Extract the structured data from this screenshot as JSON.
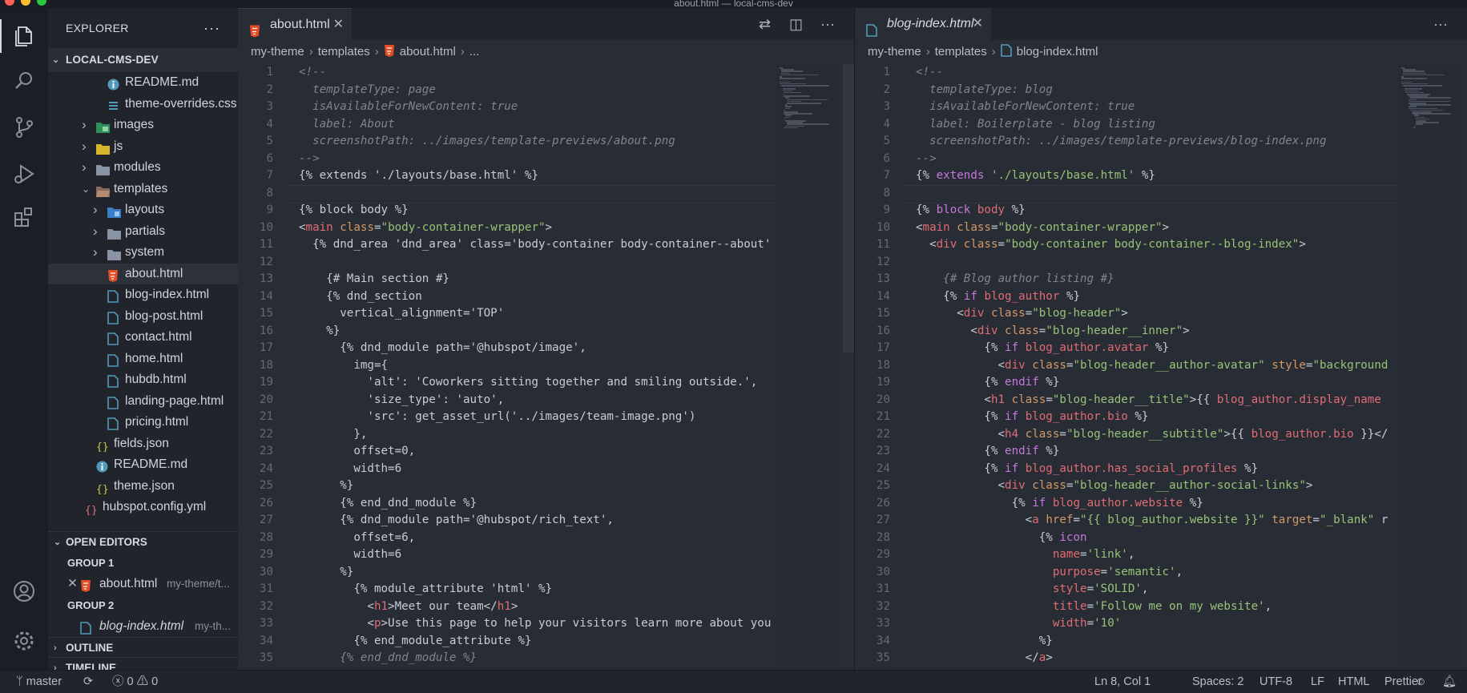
{
  "window": {
    "title": "about.html — local-cms-dev"
  },
  "explorer": {
    "title": "EXPLORER",
    "more": "···",
    "project": "LOCAL-CMS-DEV",
    "tree": [
      {
        "label": "README.md",
        "icon": "info-icon",
        "indent": 3,
        "chevron": ""
      },
      {
        "label": "theme-overrides.css",
        "icon": "css-icon",
        "indent": 3,
        "chevron": ""
      },
      {
        "label": "images",
        "icon": "image-folder-icon",
        "indent": 2,
        "chevron": "›"
      },
      {
        "label": "js",
        "icon": "js-folder-icon",
        "indent": 2,
        "chevron": "›"
      },
      {
        "label": "modules",
        "icon": "folder-icon",
        "indent": 2,
        "chevron": "›"
      },
      {
        "label": "templates",
        "icon": "open-folder-icon",
        "indent": 2,
        "chevron": "⌄"
      },
      {
        "label": "layouts",
        "icon": "layout-folder-icon",
        "indent": 3,
        "chevron": "›"
      },
      {
        "label": "partials",
        "icon": "folder-icon",
        "indent": 3,
        "chevron": "›"
      },
      {
        "label": "system",
        "icon": "folder-icon",
        "indent": 3,
        "chevron": "›"
      },
      {
        "label": "about.html",
        "icon": "html-icon",
        "indent": 3,
        "chevron": "",
        "selected": true
      },
      {
        "label": "blog-index.html",
        "icon": "file-icon",
        "indent": 3,
        "chevron": ""
      },
      {
        "label": "blog-post.html",
        "icon": "file-icon",
        "indent": 3,
        "chevron": ""
      },
      {
        "label": "contact.html",
        "icon": "file-icon",
        "indent": 3,
        "chevron": ""
      },
      {
        "label": "home.html",
        "icon": "file-icon",
        "indent": 3,
        "chevron": ""
      },
      {
        "label": "hubdb.html",
        "icon": "file-icon",
        "indent": 3,
        "chevron": ""
      },
      {
        "label": "landing-page.html",
        "icon": "file-icon",
        "indent": 3,
        "chevron": ""
      },
      {
        "label": "pricing.html",
        "icon": "file-icon",
        "indent": 3,
        "chevron": ""
      },
      {
        "label": "fields.json",
        "icon": "json-icon",
        "indent": 2,
        "chevron": ""
      },
      {
        "label": "README.md",
        "icon": "info-icon",
        "indent": 2,
        "chevron": ""
      },
      {
        "label": "theme.json",
        "icon": "json-icon",
        "indent": 2,
        "chevron": ""
      },
      {
        "label": "hubspot.config.yml",
        "icon": "yml-icon",
        "indent": 1,
        "chevron": ""
      }
    ],
    "open_editors": {
      "title": "OPEN EDITORS",
      "group1": "GROUP 1",
      "group1_file": "about.html",
      "group1_path": "my-theme/t...",
      "group2": "GROUP 2",
      "group2_file": "blog-index.html",
      "group2_path": "my-th..."
    },
    "outline": "OUTLINE",
    "timeline": "TIMELINE"
  },
  "editor_left": {
    "tab": "about.html",
    "breadcrumb": [
      "my-theme",
      "templates",
      "about.html",
      "..."
    ],
    "lines": [
      [
        [
          "c-cm",
          "<!--"
        ]
      ],
      [
        [
          "c-cm",
          "  templateType: page"
        ]
      ],
      [
        [
          "c-cm",
          "  isAvailableForNewContent: true"
        ]
      ],
      [
        [
          "c-cm",
          "  label: About"
        ]
      ],
      [
        [
          "c-cm",
          "  screenshotPath: ../images/template-previews/about.png"
        ]
      ],
      [
        [
          "c-cm",
          "-->"
        ]
      ],
      [
        [
          "c-tpl",
          "{% extends './layouts/base.html' %}"
        ]
      ],
      [
        [
          "c-tpl",
          ""
        ]
      ],
      [
        [
          "c-tpl",
          "{% block body %}"
        ]
      ],
      [
        [
          "c-tpl",
          "<"
        ],
        [
          "c-tag",
          "main"
        ],
        [
          "c-tpl",
          " "
        ],
        [
          "c-attr",
          "class"
        ],
        [
          "c-tpl",
          "="
        ],
        [
          "c-str",
          "\"body-container-wrapper\""
        ],
        [
          "c-tpl",
          ">"
        ]
      ],
      [
        [
          "c-tpl",
          "  {% dnd_area 'dnd_area' class='body-container body-container--about'"
        ]
      ],
      [
        [
          "c-tpl",
          ""
        ]
      ],
      [
        [
          "c-tpl",
          "    {# Main section #}"
        ]
      ],
      [
        [
          "c-tpl",
          "    {% dnd_section"
        ]
      ],
      [
        [
          "c-tpl",
          "      vertical_alignment='TOP'"
        ]
      ],
      [
        [
          "c-tpl",
          "    %}"
        ]
      ],
      [
        [
          "c-tpl",
          "      {% dnd_module path='@hubspot/image',"
        ]
      ],
      [
        [
          "c-tpl",
          "        img={"
        ]
      ],
      [
        [
          "c-tpl",
          "          'alt': 'Coworkers sitting together and smiling outside.',"
        ]
      ],
      [
        [
          "c-tpl",
          "          'size_type': 'auto',"
        ]
      ],
      [
        [
          "c-tpl",
          "          'src': get_asset_url('../images/team-image.png')"
        ]
      ],
      [
        [
          "c-tpl",
          "        },"
        ]
      ],
      [
        [
          "c-tpl",
          "        offset=0,"
        ]
      ],
      [
        [
          "c-tpl",
          "        width=6"
        ]
      ],
      [
        [
          "c-tpl",
          "      %}"
        ]
      ],
      [
        [
          "c-tpl",
          "      {% end_dnd_module %}"
        ]
      ],
      [
        [
          "c-tpl",
          "      {% dnd_module path='@hubspot/rich_text',"
        ]
      ],
      [
        [
          "c-tpl",
          "        offset=6,"
        ]
      ],
      [
        [
          "c-tpl",
          "        width=6"
        ]
      ],
      [
        [
          "c-tpl",
          "      %}"
        ]
      ],
      [
        [
          "c-tpl",
          "        {% module_attribute 'html' %}"
        ]
      ],
      [
        [
          "c-tpl",
          "          <"
        ],
        [
          "c-tag",
          "h1"
        ],
        [
          "c-tpl",
          ">Meet our team</"
        ],
        [
          "c-tag",
          "h1"
        ],
        [
          "c-tpl",
          ">"
        ]
      ],
      [
        [
          "c-tpl",
          "          <"
        ],
        [
          "c-tag",
          "p"
        ],
        [
          "c-tpl",
          ">Use this page to help your visitors learn more about you"
        ]
      ],
      [
        [
          "c-tpl",
          "        {% end_module_attribute %}"
        ]
      ],
      [
        [
          "c-cm",
          "      {% end_dnd_module %}"
        ]
      ]
    ]
  },
  "editor_right": {
    "tab": "blog-index.html",
    "breadcrumb": [
      "my-theme",
      "templates",
      "blog-index.html"
    ],
    "lines": [
      [
        [
          "c-cm",
          "<!--"
        ]
      ],
      [
        [
          "c-cm",
          "  templateType: blog"
        ]
      ],
      [
        [
          "c-cm",
          "  isAvailableForNewContent: true"
        ]
      ],
      [
        [
          "c-cm",
          "  label: Boilerplate - blog listing"
        ]
      ],
      [
        [
          "c-cm",
          "  screenshotPath: ../images/template-previews/blog-index.png"
        ]
      ],
      [
        [
          "c-cm",
          "-->"
        ]
      ],
      [
        [
          "c-tpl",
          "{% "
        ],
        [
          "c-kw",
          "extends"
        ],
        [
          "c-tpl",
          " "
        ],
        [
          "c-str",
          "'./layouts/base.html'"
        ],
        [
          "c-tpl",
          " %}"
        ]
      ],
      [
        [
          "c-tpl",
          ""
        ]
      ],
      [
        [
          "c-tpl",
          "{% "
        ],
        [
          "c-kw",
          "block"
        ],
        [
          "c-tpl",
          " "
        ],
        [
          "c-var",
          "body"
        ],
        [
          "c-tpl",
          " %}"
        ]
      ],
      [
        [
          "c-tpl",
          "<"
        ],
        [
          "c-tag",
          "main"
        ],
        [
          "c-tpl",
          " "
        ],
        [
          "c-attr",
          "class"
        ],
        [
          "c-tpl",
          "="
        ],
        [
          "c-str",
          "\"body-container-wrapper\""
        ],
        [
          "c-tpl",
          ">"
        ]
      ],
      [
        [
          "c-tpl",
          "  <"
        ],
        [
          "c-tag",
          "div"
        ],
        [
          "c-tpl",
          " "
        ],
        [
          "c-attr",
          "class"
        ],
        [
          "c-tpl",
          "="
        ],
        [
          "c-str",
          "\"body-container body-container--blog-index\""
        ],
        [
          "c-tpl",
          ">"
        ]
      ],
      [
        [
          "c-tpl",
          ""
        ]
      ],
      [
        [
          "c-cm",
          "    {# Blog author listing #}"
        ]
      ],
      [
        [
          "c-tpl",
          "    {% "
        ],
        [
          "c-kw",
          "if"
        ],
        [
          "c-tpl",
          " "
        ],
        [
          "c-var",
          "blog_author"
        ],
        [
          "c-tpl",
          " %}"
        ]
      ],
      [
        [
          "c-tpl",
          "      <"
        ],
        [
          "c-tag",
          "div"
        ],
        [
          "c-tpl",
          " "
        ],
        [
          "c-attr",
          "class"
        ],
        [
          "c-tpl",
          "="
        ],
        [
          "c-str",
          "\"blog-header\""
        ],
        [
          "c-tpl",
          ">"
        ]
      ],
      [
        [
          "c-tpl",
          "        <"
        ],
        [
          "c-tag",
          "div"
        ],
        [
          "c-tpl",
          " "
        ],
        [
          "c-attr",
          "class"
        ],
        [
          "c-tpl",
          "="
        ],
        [
          "c-str",
          "\"blog-header__inner\""
        ],
        [
          "c-tpl",
          ">"
        ]
      ],
      [
        [
          "c-tpl",
          "          {% "
        ],
        [
          "c-kw",
          "if"
        ],
        [
          "c-tpl",
          " "
        ],
        [
          "c-var",
          "blog_author.avatar"
        ],
        [
          "c-tpl",
          " %}"
        ]
      ],
      [
        [
          "c-tpl",
          "            <"
        ],
        [
          "c-tag",
          "div"
        ],
        [
          "c-tpl",
          " "
        ],
        [
          "c-attr",
          "class"
        ],
        [
          "c-tpl",
          "="
        ],
        [
          "c-str",
          "\"blog-header__author-avatar\""
        ],
        [
          "c-tpl",
          " "
        ],
        [
          "c-attr",
          "style"
        ],
        [
          "c-tpl",
          "="
        ],
        [
          "c-str",
          "\"background"
        ]
      ],
      [
        [
          "c-tpl",
          "          {% "
        ],
        [
          "c-kw",
          "endif"
        ],
        [
          "c-tpl",
          " %}"
        ]
      ],
      [
        [
          "c-tpl",
          "          <"
        ],
        [
          "c-tag",
          "h1"
        ],
        [
          "c-tpl",
          " "
        ],
        [
          "c-attr",
          "class"
        ],
        [
          "c-tpl",
          "="
        ],
        [
          "c-str",
          "\"blog-header__title\""
        ],
        [
          "c-tpl",
          ">{{ "
        ],
        [
          "c-var",
          "blog_author.display_name"
        ]
      ],
      [
        [
          "c-tpl",
          "          {% "
        ],
        [
          "c-kw",
          "if"
        ],
        [
          "c-tpl",
          " "
        ],
        [
          "c-var",
          "blog_author.bio"
        ],
        [
          "c-tpl",
          " %}"
        ]
      ],
      [
        [
          "c-tpl",
          "            <"
        ],
        [
          "c-tag",
          "h4"
        ],
        [
          "c-tpl",
          " "
        ],
        [
          "c-attr",
          "class"
        ],
        [
          "c-tpl",
          "="
        ],
        [
          "c-str",
          "\"blog-header__subtitle\""
        ],
        [
          "c-tpl",
          ">{{ "
        ],
        [
          "c-var",
          "blog_author.bio"
        ],
        [
          "c-tpl",
          " }}</"
        ]
      ],
      [
        [
          "c-tpl",
          "          {% "
        ],
        [
          "c-kw",
          "endif"
        ],
        [
          "c-tpl",
          " %}"
        ]
      ],
      [
        [
          "c-tpl",
          "          {% "
        ],
        [
          "c-kw",
          "if"
        ],
        [
          "c-tpl",
          " "
        ],
        [
          "c-var",
          "blog_author.has_social_profiles"
        ],
        [
          "c-tpl",
          " %}"
        ]
      ],
      [
        [
          "c-tpl",
          "            <"
        ],
        [
          "c-tag",
          "div"
        ],
        [
          "c-tpl",
          " "
        ],
        [
          "c-attr",
          "class"
        ],
        [
          "c-tpl",
          "="
        ],
        [
          "c-str",
          "\"blog-header__author-social-links\""
        ],
        [
          "c-tpl",
          ">"
        ]
      ],
      [
        [
          "c-tpl",
          "              {% "
        ],
        [
          "c-kw",
          "if"
        ],
        [
          "c-tpl",
          " "
        ],
        [
          "c-var",
          "blog_author.website"
        ],
        [
          "c-tpl",
          " %}"
        ]
      ],
      [
        [
          "c-tpl",
          "                <"
        ],
        [
          "c-tag",
          "a"
        ],
        [
          "c-tpl",
          " "
        ],
        [
          "c-attr",
          "href"
        ],
        [
          "c-tpl",
          "="
        ],
        [
          "c-str",
          "\"{{ blog_author.website }}\""
        ],
        [
          "c-tpl",
          " "
        ],
        [
          "c-attr",
          "target"
        ],
        [
          "c-tpl",
          "="
        ],
        [
          "c-str",
          "\"_blank\""
        ],
        [
          "c-tpl",
          " r"
        ]
      ],
      [
        [
          "c-tpl",
          "                  {% "
        ],
        [
          "c-kw",
          "icon"
        ]
      ],
      [
        [
          "c-tpl",
          "                    "
        ],
        [
          "c-var",
          "name"
        ],
        [
          "c-tpl",
          "="
        ],
        [
          "c-str",
          "'link'"
        ],
        [
          "c-tpl",
          ","
        ]
      ],
      [
        [
          "c-tpl",
          "                    "
        ],
        [
          "c-var",
          "purpose"
        ],
        [
          "c-tpl",
          "="
        ],
        [
          "c-str",
          "'semantic'"
        ],
        [
          "c-tpl",
          ","
        ]
      ],
      [
        [
          "c-tpl",
          "                    "
        ],
        [
          "c-var",
          "style"
        ],
        [
          "c-tpl",
          "="
        ],
        [
          "c-str",
          "'SOLID'"
        ],
        [
          "c-tpl",
          ","
        ]
      ],
      [
        [
          "c-tpl",
          "                    "
        ],
        [
          "c-var",
          "title"
        ],
        [
          "c-tpl",
          "="
        ],
        [
          "c-str",
          "'Follow me on my website'"
        ],
        [
          "c-tpl",
          ","
        ]
      ],
      [
        [
          "c-tpl",
          "                    "
        ],
        [
          "c-var",
          "width"
        ],
        [
          "c-tpl",
          "="
        ],
        [
          "c-str",
          "'10'"
        ]
      ],
      [
        [
          "c-tpl",
          "                  %}"
        ]
      ],
      [
        [
          "c-tpl",
          "                </"
        ],
        [
          "c-tag",
          "a"
        ],
        [
          "c-tpl",
          ">"
        ]
      ]
    ]
  },
  "statusbar": {
    "branch": "master",
    "errors": "0",
    "warnings": "0",
    "position": "Ln 8, Col 1",
    "spaces": "Spaces: 2",
    "encoding": "UTF-8",
    "eol": "LF",
    "language": "HTML",
    "formatter": "Prettier"
  },
  "colors": {
    "accent": "#e44d26",
    "file_icon": "#519aba",
    "background": "#282c34"
  }
}
